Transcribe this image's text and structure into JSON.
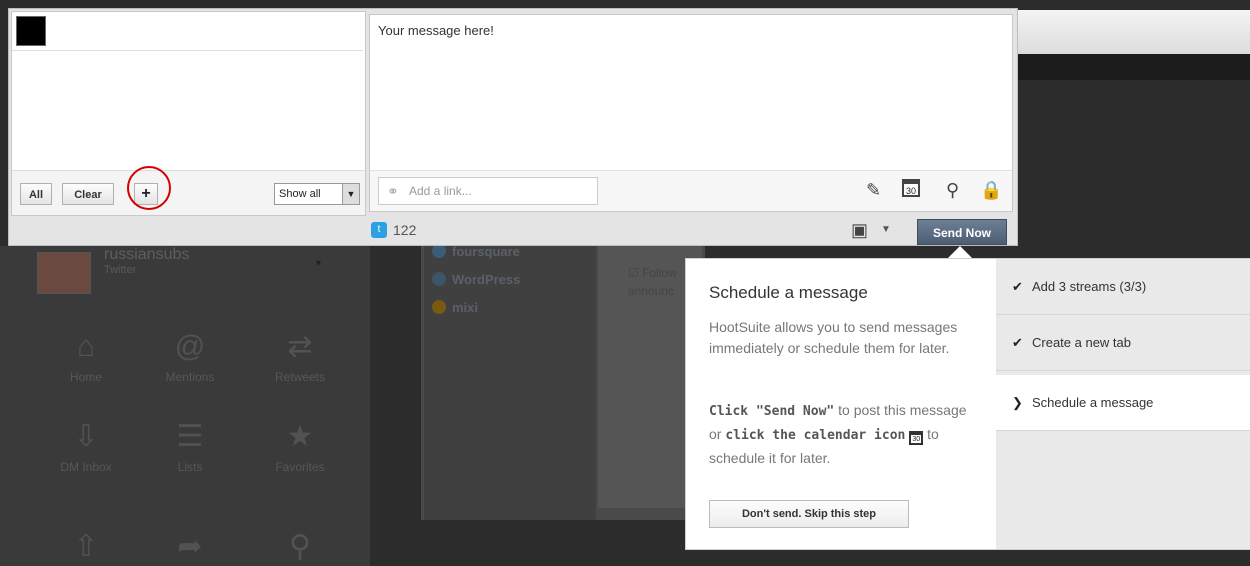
{
  "background": {
    "profile": {
      "name": "russiansubs",
      "network": "Twitter"
    },
    "nav": [
      {
        "label": "Home",
        "icon": "home-icon",
        "glyph": "⌂"
      },
      {
        "label": "Mentions",
        "icon": "at-icon",
        "glyph": "@"
      },
      {
        "label": "Retweets",
        "icon": "retweet-icon",
        "glyph": "⇄"
      },
      {
        "label": "DM Inbox",
        "icon": "inbox-icon",
        "glyph": "⇩"
      },
      {
        "label": "Lists",
        "icon": "list-icon",
        "glyph": "☰"
      },
      {
        "label": "Favorites",
        "icon": "star-icon",
        "glyph": "★"
      },
      {
        "label": "",
        "icon": "outbox-icon",
        "glyph": "⇧"
      },
      {
        "label": "",
        "icon": "share-icon",
        "glyph": "➦"
      },
      {
        "label": "",
        "icon": "search-icon",
        "glyph": "⚲"
      }
    ],
    "networks": [
      {
        "label": "foursquare",
        "icon": "foursquare-icon",
        "color": "#3a88c6"
      },
      {
        "label": "WordPress",
        "icon": "wordpress-icon",
        "color": "#3d6b8c"
      },
      {
        "label": "mixi",
        "icon": "mixi-icon",
        "color": "#c98a00"
      }
    ],
    "follow_text": "Follow",
    "announce_text": "announc"
  },
  "composer": {
    "all_label": "All",
    "clear_label": "Clear",
    "add_label": "+",
    "show_select": "Show all",
    "message": "Your message here!",
    "link_placeholder": "Add a link...",
    "char_count": "122",
    "send_label": "Send Now",
    "calendar_day": "30"
  },
  "tour": {
    "title": "Schedule a message",
    "description": "HootSuite allows you to send messages immediately or schedule them for later.",
    "instr_part1": "Click \"Send Now\"",
    "instr_part2": " to post this message or ",
    "instr_part3": "click the calendar icon",
    "instr_part4": " to schedule it for later.",
    "skip_label": "Don't send. Skip this step",
    "steps": [
      {
        "label": "Add 3 streams (3/3)",
        "state": "done"
      },
      {
        "label": "Create a new tab",
        "state": "done"
      },
      {
        "label": "Schedule a message",
        "state": "current"
      }
    ]
  }
}
